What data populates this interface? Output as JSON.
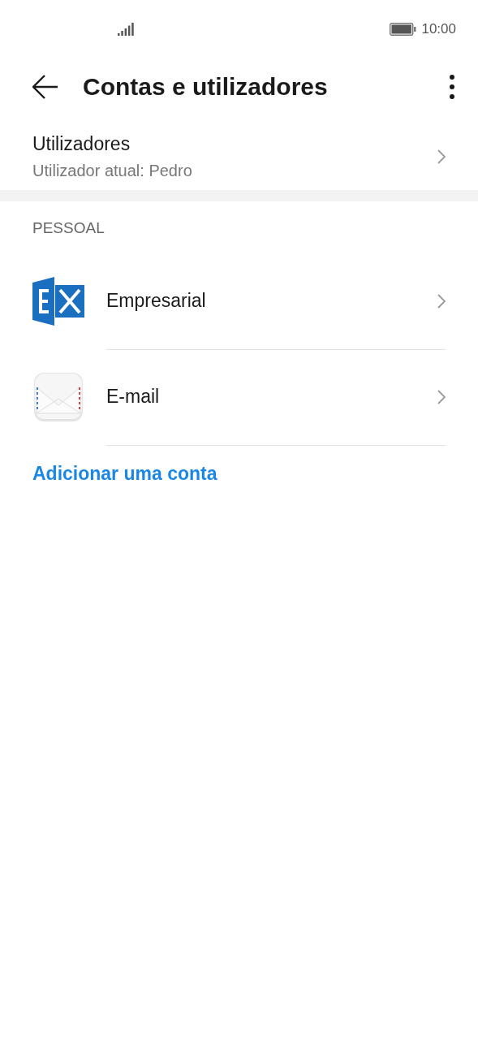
{
  "status_bar": {
    "time": "10:00"
  },
  "header": {
    "title": "Contas e utilizadores"
  },
  "users": {
    "title": "Utilizadores",
    "subtitle": "Utilizador atual: Pedro"
  },
  "section": {
    "title": "PESSOAL"
  },
  "accounts": [
    {
      "kind": "exchange",
      "label": "Empresarial"
    },
    {
      "kind": "email",
      "label": "E-mail"
    }
  ],
  "add_link": "Adicionar uma conta"
}
